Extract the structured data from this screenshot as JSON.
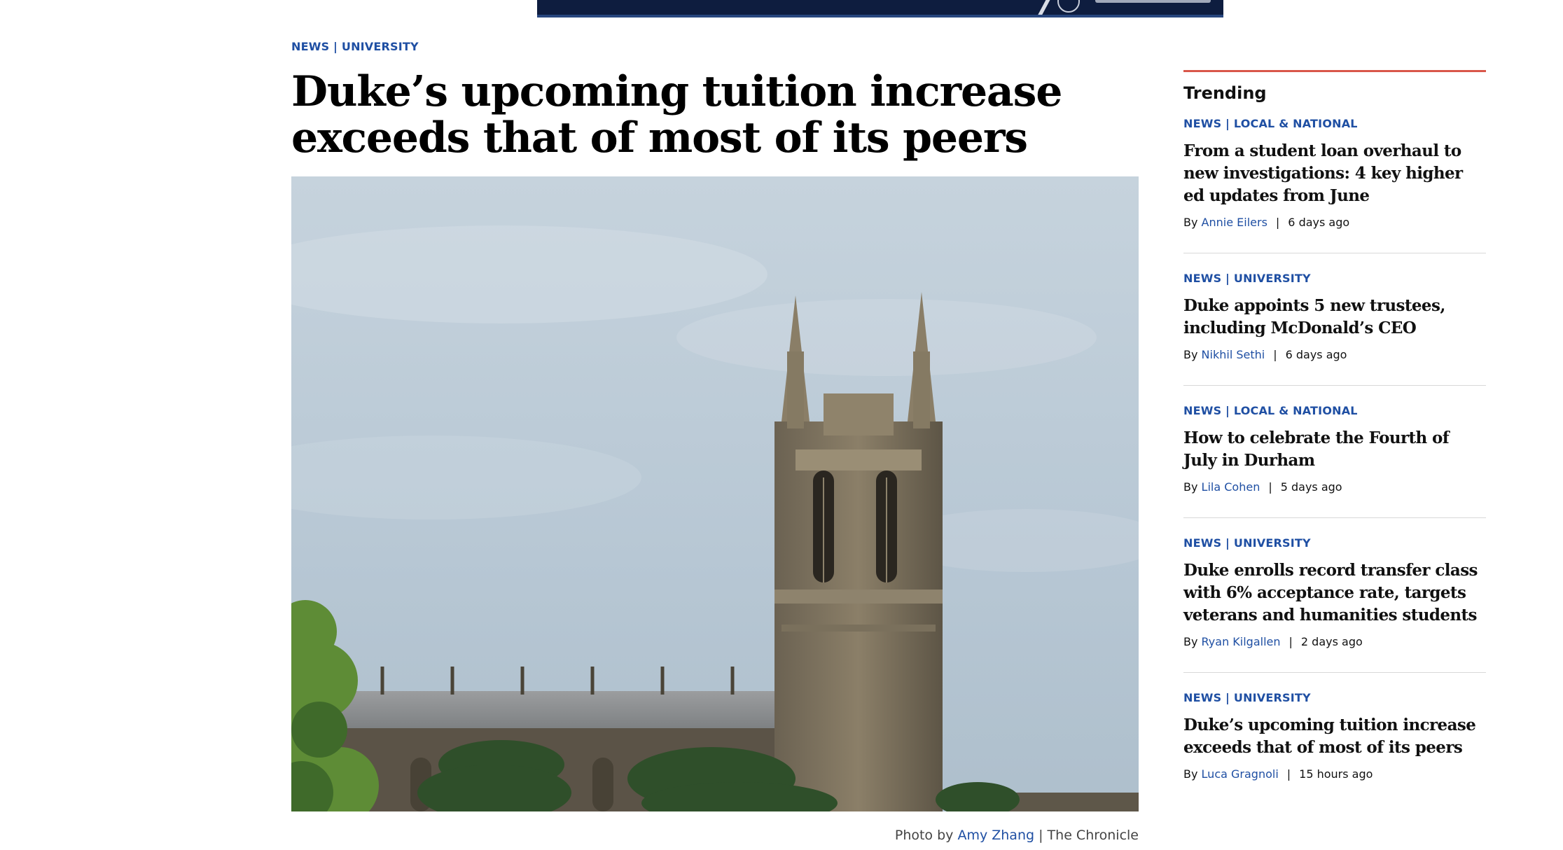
{
  "article": {
    "category": "NEWS | UNIVERSITY",
    "headline": "Duke’s upcoming tuition increase exceeds that of most of its peers",
    "caption": {
      "prefix": "Photo by",
      "photographer": "Amy Zhang",
      "separator": "|",
      "outlet": "The Chronicle"
    }
  },
  "sidebar": {
    "title": "Trending",
    "stories": [
      {
        "category": "NEWS | LOCAL & NATIONAL",
        "headline": "From a student loan overhaul to new investigations: 4 key higher ed updates from June",
        "by": "By",
        "author": "Annie Eilers",
        "sep": "|",
        "time": "6 days ago"
      },
      {
        "category": "NEWS | UNIVERSITY",
        "headline": "Duke appoints 5 new trustees, including McDonald’s CEO",
        "by": "By",
        "author": "Nikhil Sethi",
        "sep": "|",
        "time": "6 days ago"
      },
      {
        "category": "NEWS | LOCAL & NATIONAL",
        "headline": "How to celebrate the Fourth of July in Durham",
        "by": "By",
        "author": "Lila Cohen",
        "sep": "|",
        "time": "5 days ago"
      },
      {
        "category": "NEWS | UNIVERSITY",
        "headline": "Duke enrolls record transfer class with 6% acceptance rate, targets veterans and humanities students",
        "by": "By",
        "author": "Ryan Kilgallen",
        "sep": "|",
        "time": "2 days ago"
      },
      {
        "category": "NEWS | UNIVERSITY",
        "headline": "Duke’s upcoming tuition increase exceeds that of most of its peers",
        "by": "By",
        "author": "Luca Gragnoli",
        "sep": "|",
        "time": "15 hours ago"
      }
    ]
  }
}
